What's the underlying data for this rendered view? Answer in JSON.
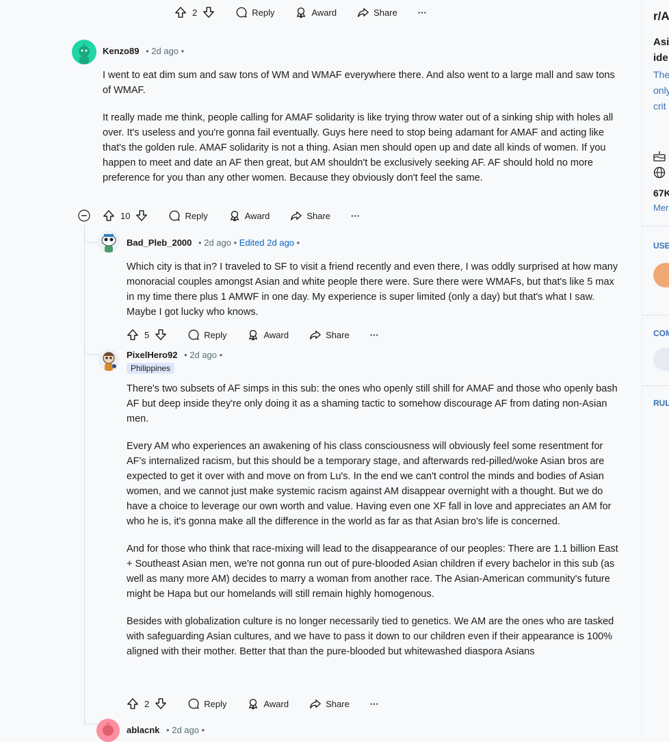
{
  "top_actions": {
    "votes": "2",
    "reply": "Reply",
    "award": "Award",
    "share": "Share",
    "more": "···"
  },
  "comments": [
    {
      "author": "Kenzo89",
      "time": "2d ago",
      "dot_after": "•",
      "paragraphs": [
        "I went to eat dim sum and saw tons of WM and WMAF everywhere there. And also went to a large mall and saw tons of WMAF.",
        "It really made me think, people calling for AMAF solidarity is like trying throw water out of a sinking ship with holes all over. It's useless and you're gonna fail eventually. Guys here need to stop being adamant for AMAF and acting like that's the golden rule. AMAF solidarity is not a thing. Asian men should open up and date all kinds of women. If you happen to meet and date an AF then great, but AM shouldn't be exclusively seeking AF. AF should hold no more preference for you than any other women. Because they obviously don't feel the same."
      ],
      "votes": "10",
      "reply": "Reply",
      "award": "Award",
      "share": "Share",
      "more": "···"
    },
    {
      "author": "Bad_Pleb_2000",
      "time": "2d ago",
      "edited": "Edited 2d ago",
      "paragraphs": [
        "Which city is that in? I traveled to SF to visit a friend recently and even there, I was oddly surprised at how many monoracial couples amongst Asian and white people there were. Sure there were WMAFs, but that's like 5 max in my time there plus 1 AMWF in one day. My experience is super limited (only a day) but that's what I saw. Maybe I got lucky who knows."
      ],
      "votes": "5",
      "reply": "Reply",
      "award": "Award",
      "share": "Share",
      "more": "···"
    },
    {
      "author": "PixelHero92",
      "time": "2d ago",
      "flair": "Philippines",
      "paragraphs": [
        "There's two subsets of AF simps in this sub: the ones who openly still shill for AMAF and those who openly bash AF but deep inside they're only doing it as a shaming tactic to somehow discourage AF from dating non-Asian men.",
        "Every AM who experiences an awakening of his class consciousness will obviously feel some resentment for AF's internalized racism, but this should be a temporary stage, and afterwards red-pilled/woke Asian bros are expected to get it over with and move on from Lu's. In the end we can't control the minds and bodies of Asian women, and we cannot just make systemic racism against AM disappear overnight with a thought. But we do have a choice to leverage our own worth and value. Having even one XF fall in love and appreciates an AM for who he is, it's gonna make all the difference in the world as far as that Asian bro's life is concerned.",
        "And for those who think that race-mixing will lead to the disappearance of our peoples: There are 1.1 billion East + Southeast Asian men, we're not gonna run out of pure-blooded Asian children if every bachelor in this sub (as well as many more AM) decides to marry a woman from another race. The Asian-American community's future might be Hapa but our homelands will still remain highly homogenous.",
        "Besides with globalization culture is no longer necessarily tied to genetics. We AM are the ones who are tasked with safeguarding Asian cultures, and we have to pass it down to our children even if their appearance is 100% aligned with their mother. Better that than the pure-blooded but whitewashed diaspora Asians"
      ],
      "votes": "2",
      "reply": "Reply",
      "award": "Award",
      "share": "Share",
      "more": "···"
    },
    {
      "author": "ablacnk",
      "time": "2d ago"
    }
  ],
  "sidebar": {
    "sub_name": "r/A",
    "title_1": "Asi",
    "title_2": "ide",
    "desc_1": "The",
    "desc_2": "only",
    "desc_3": "crit",
    "members": "67K",
    "members_label": "Mer",
    "section_user": "USE",
    "section_comm": "COM",
    "section_rules": "RUL"
  },
  "colors": {
    "accent": "#0a65c2",
    "line": "#d9dfe3",
    "flair_bg": "#dfe6fb"
  }
}
